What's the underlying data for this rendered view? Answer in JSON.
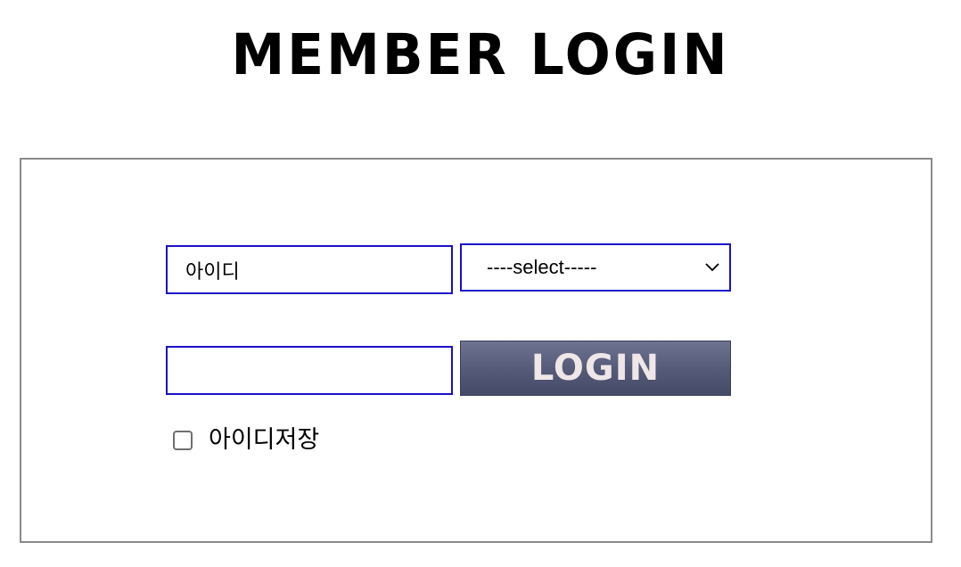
{
  "page": {
    "title": "MEMBER LOGIN"
  },
  "form": {
    "id_value": "아이디",
    "password_value": "",
    "select_value": "----select-----",
    "login_button_label": "LOGIN",
    "remember_label": "아이디저장",
    "remember_checked": false
  },
  "icons": {
    "select_arrow": "chevron-down-icon"
  },
  "colors": {
    "input_border": "#1a10c8",
    "box_border": "#8a8a8a",
    "button_bg": "#555b78",
    "button_text": "#efe6e8"
  }
}
